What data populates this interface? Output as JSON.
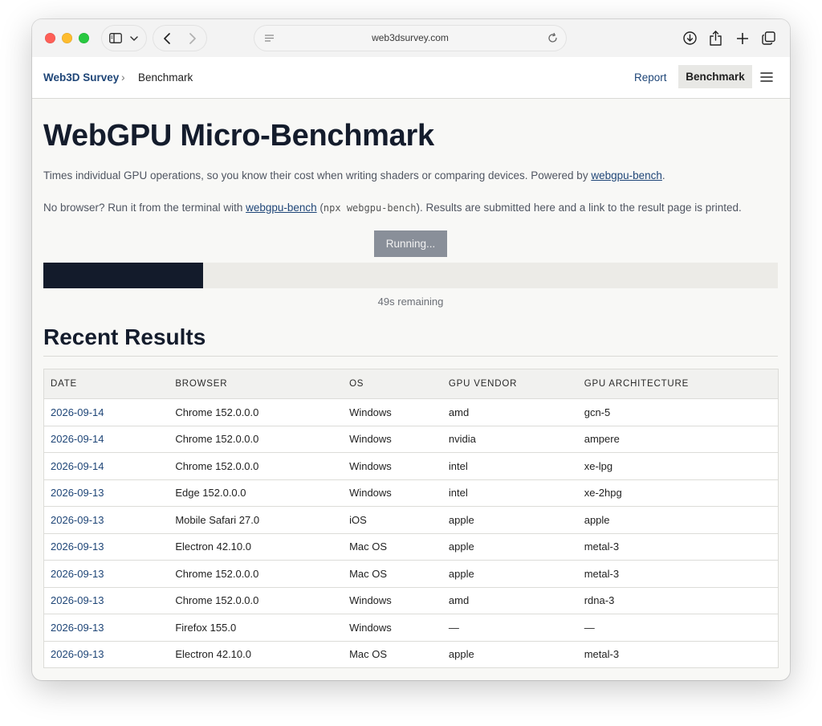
{
  "browser": {
    "url": "web3dsurvey.com"
  },
  "header": {
    "breadcrumb_home": "Web3D Survey",
    "breadcrumb_separator": "›",
    "breadcrumb_current": "Benchmark",
    "nav_report": "Report",
    "nav_benchmark": "Benchmark"
  },
  "main": {
    "title": "WebGPU Micro-Benchmark",
    "intro_text": "Times individual GPU operations, so you know their cost when writing shaders or comparing devices. Powered by ",
    "intro_link": "webgpu-bench",
    "intro_end": ".",
    "cli_prefix": "No browser? Run it from the terminal with ",
    "cli_link": "webgpu-bench",
    "cli_open": " (",
    "cli_code": "npx webgpu-bench",
    "cli_suffix": "). Results are submitted here and a link to the result page is printed.",
    "run_button": "Running...",
    "progress_fraction": 0.218,
    "remaining": "49s remaining"
  },
  "results": {
    "title": "Recent Results",
    "columns": [
      "Date",
      "Browser",
      "OS",
      "GPU Vendor",
      "GPU Architecture"
    ],
    "rows": [
      [
        "2026-09-14",
        "Chrome 152.0.0.0",
        "Windows",
        "amd",
        "gcn-5"
      ],
      [
        "2026-09-14",
        "Chrome 152.0.0.0",
        "Windows",
        "nvidia",
        "ampere"
      ],
      [
        "2026-09-14",
        "Chrome 152.0.0.0",
        "Windows",
        "intel",
        "xe-lpg"
      ],
      [
        "2026-09-13",
        "Edge 152.0.0.0",
        "Windows",
        "intel",
        "xe-2hpg"
      ],
      [
        "2026-09-13",
        "Mobile Safari 27.0",
        "iOS",
        "apple",
        "apple"
      ],
      [
        "2026-09-13",
        "Electron 42.10.0",
        "Mac OS",
        "apple",
        "metal-3"
      ],
      [
        "2026-09-13",
        "Chrome 152.0.0.0",
        "Mac OS",
        "apple",
        "metal-3"
      ],
      [
        "2026-09-13",
        "Chrome 152.0.0.0",
        "Windows",
        "amd",
        "rdna-3"
      ],
      [
        "2026-09-13",
        "Firefox 155.0",
        "Windows",
        "—",
        "—"
      ],
      [
        "2026-09-13",
        "Electron 42.10.0",
        "Mac OS",
        "apple",
        "metal-3"
      ]
    ]
  },
  "icons": {
    "sidebar": "sidebar-icon",
    "chevron_down": "chevron-down-icon",
    "back": "back-arrow-icon",
    "forward": "forward-arrow-icon",
    "reader": "reader-icon",
    "reload": "reload-icon",
    "download": "download-icon",
    "share": "share-icon",
    "new_tab": "plus-icon",
    "tabs": "tabs-icon",
    "menu": "hamburger-menu-icon"
  },
  "colors": {
    "accent_link": "#1e4577",
    "progress_fill": "#131b2b",
    "button_disabled": "#898f99"
  }
}
